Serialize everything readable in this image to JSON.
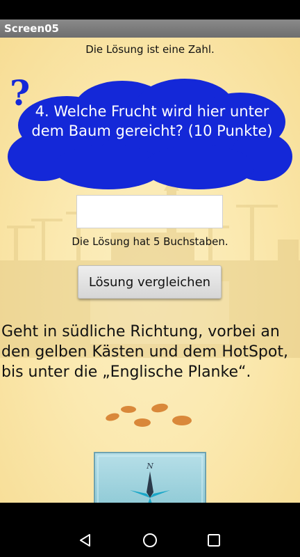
{
  "app": {
    "title": "Screen05"
  },
  "hint_top": "Die Lösung ist eine Zahl.",
  "question": {
    "mark": "?",
    "text": "4. Welche Frucht wird hier unter dem Baum gereicht? (10 Punkte)"
  },
  "answer": {
    "value": "",
    "placeholder": ""
  },
  "hint_length": "Die Lösung hat 5 Buchstaben.",
  "compare_button": "Lösung vergleichen",
  "directions": "Geht in südliche Richtung, vorbei an den gelben Kästen und dem HotSpot, bis unter die „Englische Planke“.",
  "compass": {
    "north_label": "N"
  },
  "colors": {
    "cloud": "#1428d8",
    "background": "#fbe9b0",
    "footprints": "#d9883a"
  },
  "icons": [
    "question-mark-icon",
    "footprints-icon",
    "compass-icon",
    "back-icon",
    "home-icon",
    "recents-icon"
  ]
}
